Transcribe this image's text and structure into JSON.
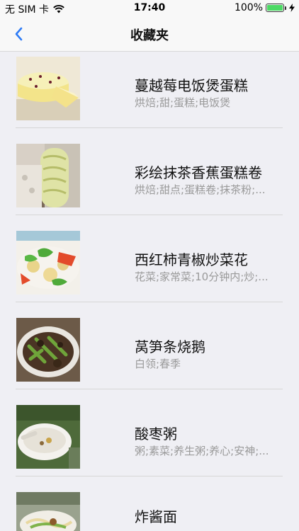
{
  "status_bar": {
    "carrier": "无 SIM 卡",
    "time": "17:40",
    "battery_percent": "100%",
    "battery_level": 1.0,
    "wifi_icon": "wifi-icon",
    "charging_icon": "bolt-icon"
  },
  "nav": {
    "title": "收藏夹",
    "back_icon": "chevron-left-icon"
  },
  "accent_color": "#2f7cf6",
  "items": [
    {
      "title": "蔓越莓电饭煲蛋糕",
      "tags": "烘焙;甜;蛋糕;电饭煲"
    },
    {
      "title": "彩绘抹茶香蕉蛋糕卷",
      "tags": "烘焙;甜点;蛋糕卷;抹茶粉;..."
    },
    {
      "title": "西红柿青椒炒菜花",
      "tags": "花菜;家常菜;10分钟内;炒;..."
    },
    {
      "title": "莴笋条烧鹅",
      "tags": "白领;春季"
    },
    {
      "title": "酸枣粥",
      "tags": "粥;素菜;养生粥;养心;安神;..."
    },
    {
      "title": "炸酱面",
      "tags": ""
    }
  ]
}
